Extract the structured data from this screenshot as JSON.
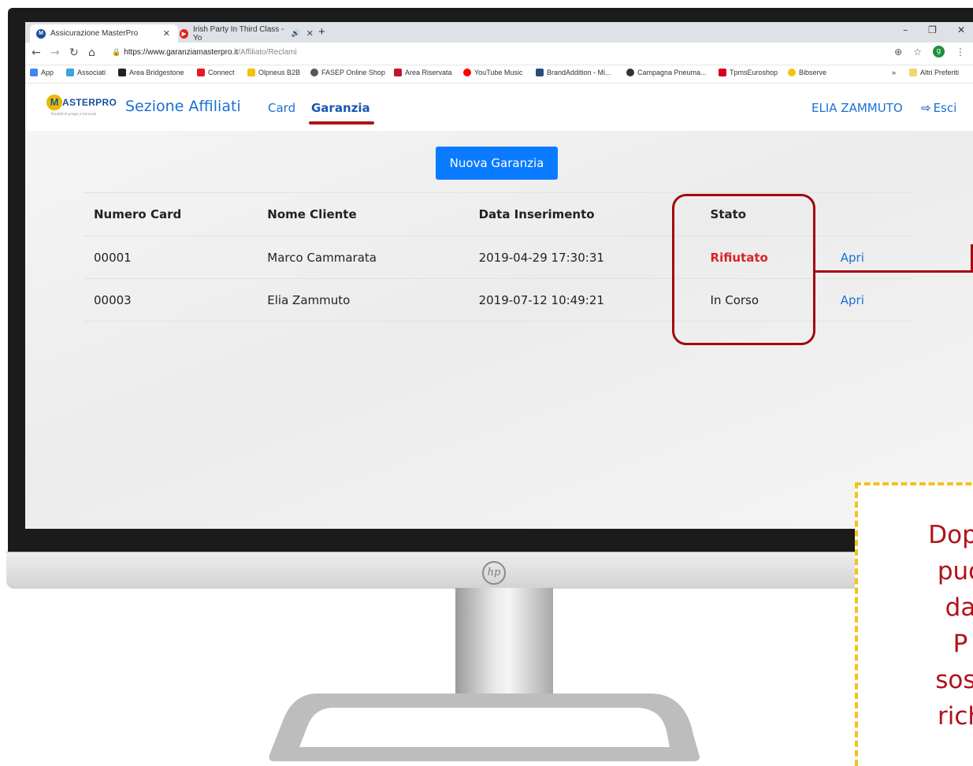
{
  "browser": {
    "tabs": [
      {
        "title": "Assicurazione MasterPro",
        "active": true
      },
      {
        "title": "Irish Party In Third Class - Yo",
        "audio": true
      }
    ],
    "url_domain": "https://www.garanziamasterpro.it",
    "url_path": "/Affiliato/Reclami",
    "profile_initial": "g",
    "bookmarks": [
      "App",
      "Associati",
      "Area Bridgestone",
      "Connect",
      "Olpneus B2B",
      "FASEP Online Shop",
      "Area Riservata",
      "YouTube Music",
      "BrandAddition - Mi...",
      "Campagna Pneuma...",
      "TpmsEuroshop",
      "Bibserve"
    ],
    "bookmarks_more": "»",
    "other_bookmarks": "Altri Preferiti"
  },
  "app": {
    "logo": {
      "letter": "M",
      "text": "ASTERPRO",
      "sub": "Prodotti di pregio e Garanzia"
    },
    "brand": "Sezione Affiliati",
    "menu": {
      "card": "Card",
      "garanzia": "Garanzia"
    },
    "user": "ELIA ZAMMUTO",
    "logout": "Esci",
    "new_button": "Nuova Garanzia",
    "table": {
      "headers": [
        "Numero Card",
        "Nome Cliente",
        "Data Inserimento",
        "Stato",
        ""
      ],
      "rows": [
        {
          "card": "00001",
          "client": "Marco Cammarata",
          "date": "2019-04-29 17:30:31",
          "status": "Rifiutato",
          "action": "Apri"
        },
        {
          "card": "00003",
          "client": "Elia Zammuto",
          "date": "2019-07-12 10:49:21",
          "status": "In Corso",
          "action": "Apri"
        }
      ]
    }
  },
  "annotation": {
    "lines": [
      "Dopa",
      "puo",
      "da",
      "P",
      "sost",
      "rich"
    ],
    "highlight_color": "#a3060d",
    "note_border_color": "#f2c318"
  }
}
